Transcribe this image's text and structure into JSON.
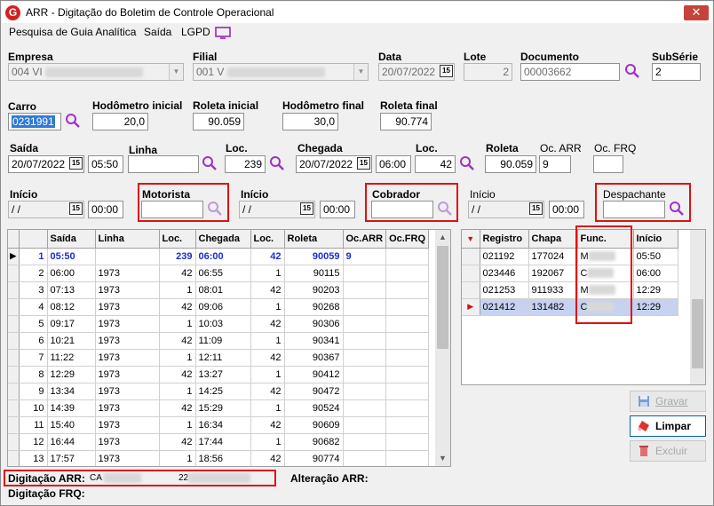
{
  "window": {
    "title": "ARR - Digitação do Boletim de Controle Operacional",
    "close_glyph": "✕",
    "app_icon_glyph": "G"
  },
  "menu": {
    "items": [
      "Pesquisa de Guia Analítica",
      "Saída",
      "LGPD"
    ]
  },
  "header": {
    "empresa_label": "Empresa",
    "empresa_value": "004 VI",
    "filial_label": "Filial",
    "filial_value": "001 V",
    "data_label": "Data",
    "data_value": "20/07/2022",
    "lote_label": "Lote",
    "lote_value": "2",
    "documento_label": "Documento",
    "documento_value": "00003662",
    "subserie_label": "SubSérie",
    "subserie_value": "2"
  },
  "carro": {
    "carro_label": "Carro",
    "carro_value": "0231991",
    "hod_ini_label": "Hodômetro inicial",
    "hod_ini_value": "20,0",
    "rol_ini_label": "Roleta inicial",
    "rol_ini_value": "90.059",
    "hod_fim_label": "Hodômetro final",
    "hod_fim_value": "30,0",
    "rol_fim_label": "Roleta final",
    "rol_fim_value": "90.774"
  },
  "viagem": {
    "saida_label": "Saída",
    "saida_date": "20/07/2022",
    "saida_time": "05:50",
    "linha_label": "Linha",
    "linha_value": "",
    "loc1_label": "Loc.",
    "loc1_value": "239",
    "chegada_label": "Chegada",
    "chegada_date": "20/07/2022",
    "chegada_time": "06:00",
    "loc2_label": "Loc.",
    "loc2_value": "42",
    "roleta_label": "Roleta",
    "roleta_value": "90.059",
    "ocarr_label": "Oc. ARR",
    "ocarr_value": "9",
    "ocfrq_label": "Oc. FRQ",
    "ocfrq_value": ""
  },
  "pessoal": {
    "inicio1_label": "Início",
    "inicio1_date": " / /",
    "inicio1_time": "00:00",
    "motorista_label": "Motorista",
    "inicio2_label": "Início",
    "inicio2_date": " / /",
    "inicio2_time": "00:00",
    "cobrador_label": "Cobrador",
    "inicio3_label": "Início",
    "inicio3_date": " / /",
    "inicio3_time": "00:00",
    "despachante_label": "Despachante"
  },
  "trips_table": {
    "columns": [
      "Saída",
      "Linha",
      "Loc.",
      "Chegada",
      "Loc.",
      "Roleta",
      "Oc.ARR",
      "Oc.FRQ"
    ],
    "rows": [
      [
        "1",
        "05:50",
        "",
        "239",
        "06:00",
        "42",
        "90059",
        "9",
        ""
      ],
      [
        "2",
        "06:00",
        "1973",
        "42",
        "06:55",
        "1",
        "90115",
        "",
        ""
      ],
      [
        "3",
        "07:13",
        "1973",
        "1",
        "08:01",
        "42",
        "90203",
        "",
        ""
      ],
      [
        "4",
        "08:12",
        "1973",
        "42",
        "09:06",
        "1",
        "90268",
        "",
        ""
      ],
      [
        "5",
        "09:17",
        "1973",
        "1",
        "10:03",
        "42",
        "90306",
        "",
        ""
      ],
      [
        "6",
        "10:21",
        "1973",
        "42",
        "11:09",
        "1",
        "90341",
        "",
        ""
      ],
      [
        "7",
        "11:22",
        "1973",
        "1",
        "12:11",
        "42",
        "90367",
        "",
        ""
      ],
      [
        "8",
        "12:29",
        "1973",
        "42",
        "13:27",
        "1",
        "90412",
        "",
        ""
      ],
      [
        "9",
        "13:34",
        "1973",
        "1",
        "14:25",
        "42",
        "90472",
        "",
        ""
      ],
      [
        "10",
        "14:39",
        "1973",
        "42",
        "15:29",
        "1",
        "90524",
        "",
        ""
      ],
      [
        "11",
        "15:40",
        "1973",
        "1",
        "16:34",
        "42",
        "90609",
        "",
        ""
      ],
      [
        "12",
        "16:44",
        "1973",
        "42",
        "17:44",
        "1",
        "90682",
        "",
        ""
      ],
      [
        "13",
        "17:57",
        "1973",
        "1",
        "18:56",
        "42",
        "90774",
        "",
        ""
      ]
    ]
  },
  "crew_table": {
    "columns": [
      "Registro",
      "Chapa",
      "Func.",
      "Início"
    ],
    "rows": [
      [
        "021192",
        "177024",
        "M",
        "05:50"
      ],
      [
        "023446",
        "192067",
        "C",
        "06:00"
      ],
      [
        "021253",
        "911933",
        "M",
        "12:29"
      ],
      [
        "021412",
        "131482",
        "C",
        "12:29"
      ]
    ]
  },
  "buttons": {
    "gravar": "Gravar",
    "limpar": "Limpar",
    "excluir": "Excluir"
  },
  "status": {
    "digitacao_arr_label": "Digitação ARR:",
    "digitacao_arr_user": "CA",
    "digitacao_arr_date": "22",
    "alteracao_arr_label": "Alteração ARR:",
    "digitacao_frq_label": "Digitação FRQ:"
  }
}
